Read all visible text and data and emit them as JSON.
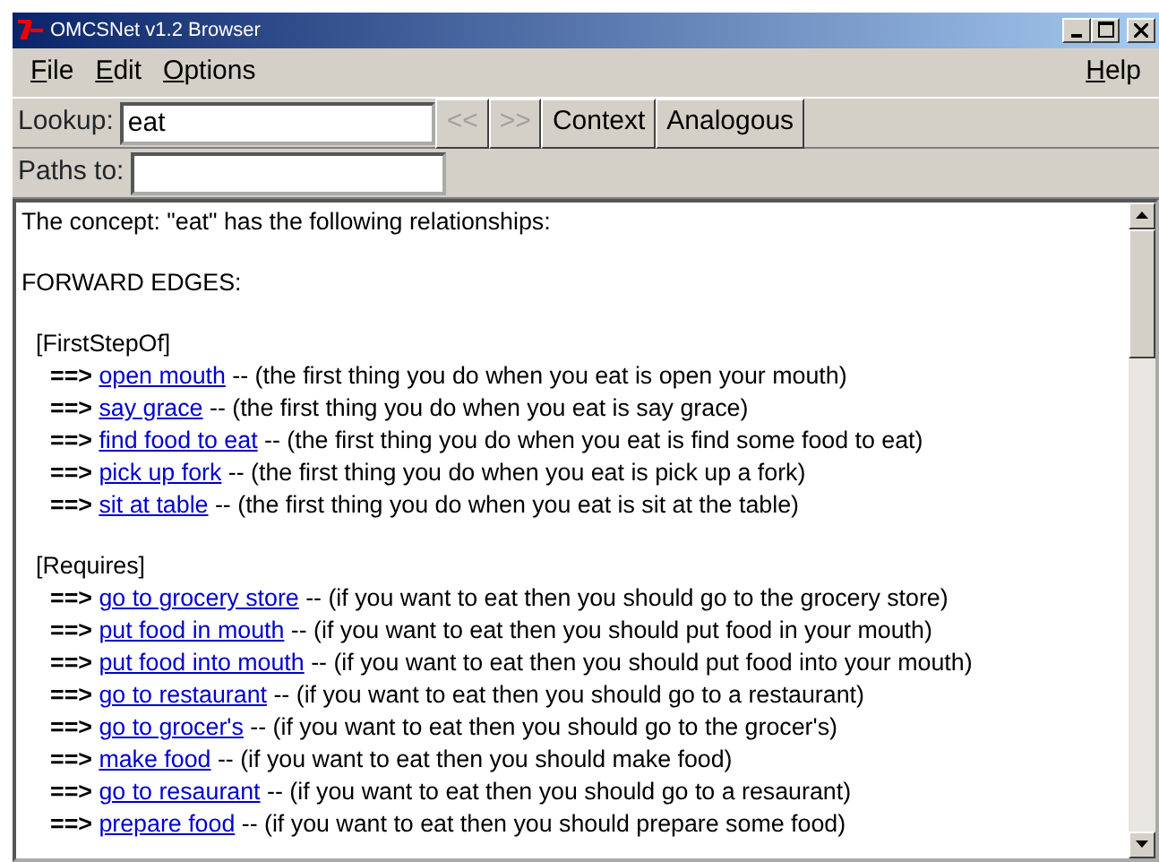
{
  "window": {
    "title": "OMCSNet v1.2 Browser"
  },
  "menu": [
    {
      "label": "File"
    },
    {
      "label": "Edit"
    },
    {
      "label": "Options"
    }
  ],
  "help_menu": {
    "label": "Help"
  },
  "lookup": {
    "label": "Lookup:",
    "value": "eat"
  },
  "toolbar_buttons": [
    {
      "label": "<<",
      "disabled": true
    },
    {
      "label": ">>",
      "disabled": true
    },
    {
      "label": "Context",
      "disabled": false
    },
    {
      "label": "Analogous",
      "disabled": false
    }
  ],
  "paths_to": {
    "label": "Paths to:"
  },
  "content": {
    "intro": "The concept: \"eat\" has the following relationships:",
    "heading": "FORWARD EDGES:",
    "groups": [
      {
        "name": "[FirstStepOf]",
        "edges": [
          {
            "arrow": "==>",
            "target": "open mouth",
            "note": "-- (the first thing you do when you eat is open your mouth)"
          },
          {
            "arrow": "==>",
            "target": "say grace",
            "note": "-- (the first thing you do when you eat is say grace)"
          },
          {
            "arrow": "==>",
            "target": "find food to eat",
            "note": "-- (the first thing you do when you eat is find some food to eat)"
          },
          {
            "arrow": "==>",
            "target": "pick up fork",
            "note": "-- (the first thing you do when you eat is pick up a fork)"
          },
          {
            "arrow": "==>",
            "target": "sit at table",
            "note": "-- (the first thing you do when you eat is sit at the table)"
          }
        ]
      },
      {
        "name": "[Requires]",
        "edges": [
          {
            "arrow": "==>",
            "target": "go to grocery store",
            "note": "-- (if you want to eat then you should go to the grocery store)"
          },
          {
            "arrow": "==>",
            "target": "put food in mouth",
            "note": "-- (if you want to eat then you should put food in your mouth)"
          },
          {
            "arrow": "==>",
            "target": "put food into mouth",
            "note": "-- (if you want to eat then you should put food into your mouth)"
          },
          {
            "arrow": "==>",
            "target": "go to restaurant",
            "note": "-- (if you want to eat then you should go to a restaurant)"
          },
          {
            "arrow": "==>",
            "target": "go to grocer's",
            "note": "-- (if you want to eat then you should go to the grocer's)"
          },
          {
            "arrow": "==>",
            "target": "make food",
            "note": "-- (if you want to eat then you should make food)"
          },
          {
            "arrow": "==>",
            "target": "go to resaurant",
            "note": "-- (if you want to eat then you should go to a resaurant)"
          },
          {
            "arrow": "==>",
            "target": "prepare food",
            "note": "-- (if you want to eat then you should prepare some food)"
          }
        ]
      }
    ]
  }
}
